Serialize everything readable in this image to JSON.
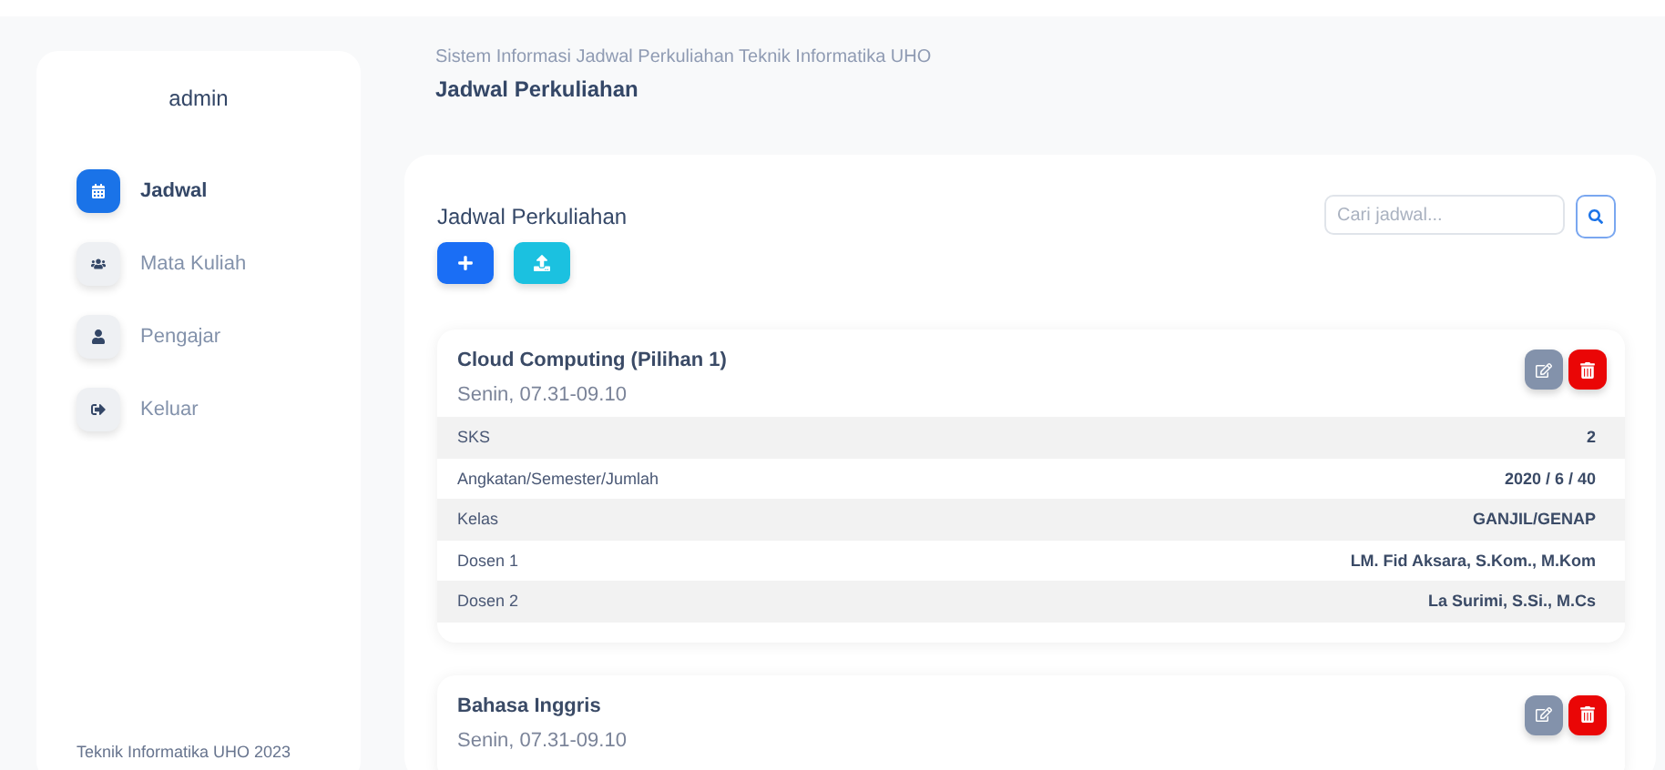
{
  "sidebar": {
    "user": "admin",
    "items": [
      {
        "kind": "calendar",
        "label": "Jadwal",
        "selected": true
      },
      {
        "kind": "users",
        "label": "Mata Kuliah",
        "selected": false
      },
      {
        "kind": "user",
        "label": "Pengajar",
        "selected": false
      },
      {
        "kind": "logout",
        "label": "Keluar",
        "selected": false
      }
    ],
    "footer": "Teknik Informatika UHO 2023"
  },
  "header": {
    "subtitle": "Sistem Informasi Jadwal Perkuliahan Teknik Informatika UHO",
    "title": "Jadwal Perkuliahan"
  },
  "panel": {
    "title": "Jadwal Perkuliahan",
    "search": {
      "placeholder": "Cari jadwal..."
    },
    "schedules": [
      {
        "course": "Cloud Computing (Pilihan 1)",
        "time": "Senin, 07.31-09.10",
        "details": [
          {
            "label": "SKS",
            "value": "2"
          },
          {
            "label": "Angkatan/Semester/Jumlah",
            "value": "2020 / 6 / 40"
          },
          {
            "label": "Kelas",
            "value": "GANJIL/GENAP"
          },
          {
            "label": "Dosen 1",
            "value": "LM. Fid Aksara, S.Kom., M.Kom"
          },
          {
            "label": "Dosen 2",
            "value": "La Surimi, S.Si., M.Cs"
          }
        ]
      },
      {
        "course": "Bahasa Inggris",
        "time": "Senin, 07.31-09.10"
      }
    ]
  }
}
